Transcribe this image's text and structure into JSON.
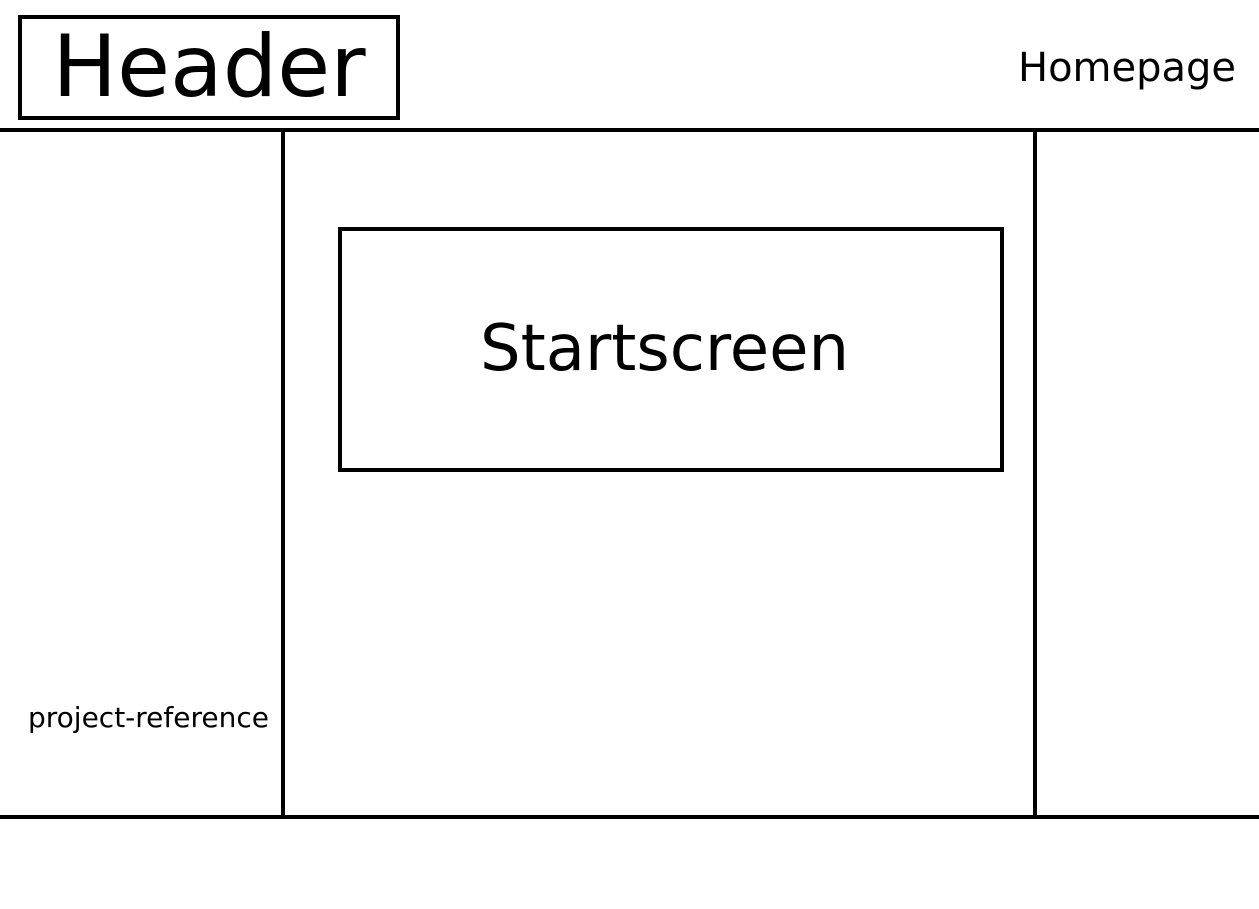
{
  "header": {
    "title": "Header",
    "page_name": "Homepage"
  },
  "main": {
    "startscreen_label": "Startscreen"
  },
  "sidebar_left": {
    "reference_label": "project-reference"
  }
}
